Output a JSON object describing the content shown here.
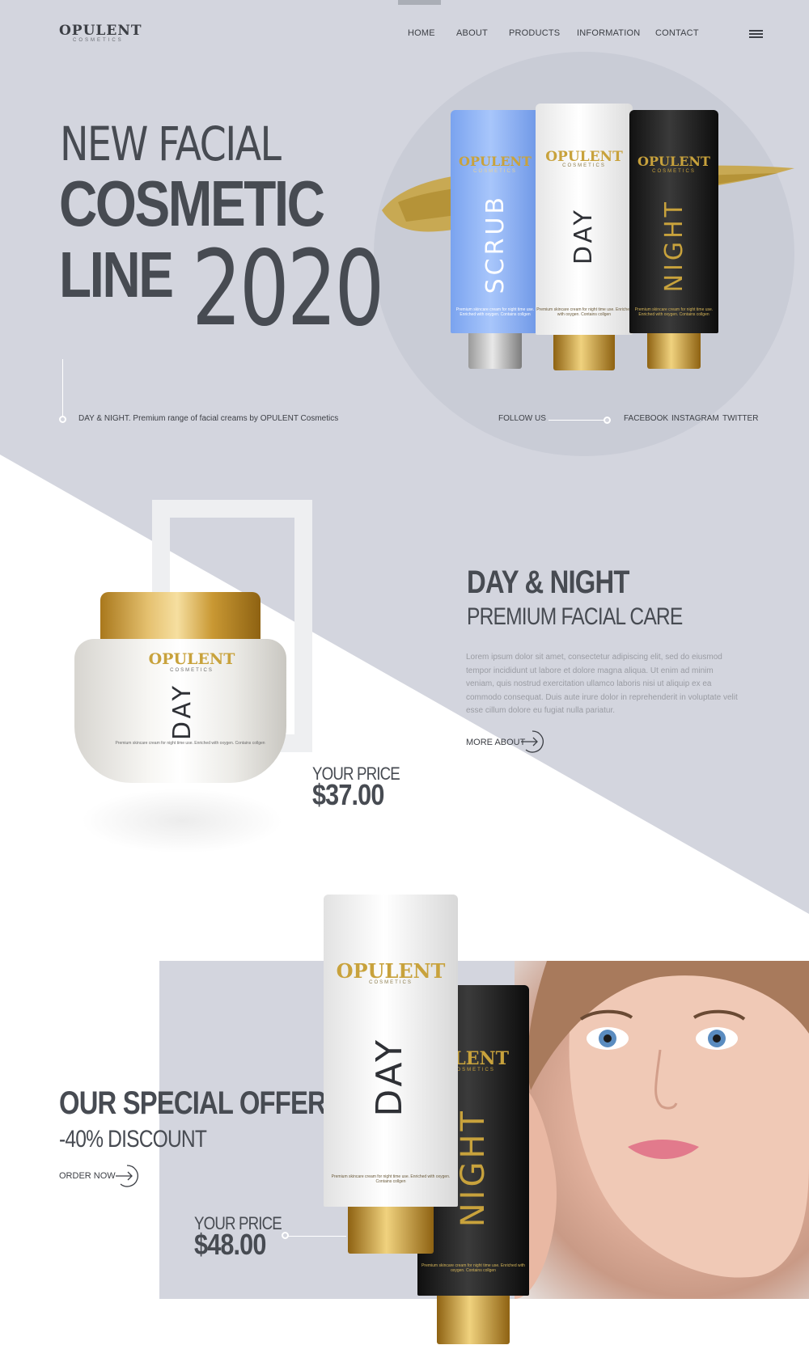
{
  "brand": {
    "name": "OPULENT",
    "tagline": "COSMETICS"
  },
  "nav": {
    "items": [
      "HOME",
      "ABOUT",
      "PRODUCTS",
      "INFORMATION",
      "CONTACT"
    ],
    "menu_icon": "hamburger-menu-icon"
  },
  "hero": {
    "line1": "NEW FACIAL",
    "line2": "COSMETIC",
    "line3": "LINE",
    "year": "2020",
    "caption": "DAY & NIGHT. Premium range of facial creams by OPULENT Cosmetics",
    "follow_label": "FOLLOW US",
    "social": [
      "FACEBOOK",
      "INSTAGRAM",
      "TWITTER"
    ],
    "tubes": [
      {
        "brand": "OPULENT",
        "sub": "COSMETICS",
        "name": "SCRUB",
        "small": "Premium skincare cream for night time use. Enriched with oxygen. Contains collgen"
      },
      {
        "brand": "OPULENT",
        "sub": "COSMETICS",
        "name": "DAY",
        "small": "Premium skincare cream for night time use. Enriched with oxygen. Contains collgen"
      },
      {
        "brand": "OPULENT",
        "sub": "COSMETICS",
        "name": "NIGHT",
        "small": "Premium skincare cream for night time use. Enriched with oxygen. Contains collgen"
      }
    ]
  },
  "day_night": {
    "title": "DAY & NIGHT",
    "subtitle": "PREMIUM FACIAL CARE",
    "body": "Lorem ipsum dolor sit amet, consectetur adipiscing elit, sed do eiusmod tempor incididunt ut labore et dolore magna aliqua. Ut enim ad minim veniam, quis nostrud exercitation ullamco laboris nisi ut aliquip ex ea commodo consequat. Duis aute irure dolor in reprehenderit in voluptate velit esse cillum dolore eu fugiat nulla pariatur.",
    "link": "MORE ABOUT",
    "price_label": "YOUR PRICE",
    "price": "$37.00",
    "jar": {
      "brand": "OPULENT",
      "sub": "COSMETICS",
      "name": "DAY",
      "small": "Premium skincare cream for night time use. Enriched with oxygen. Contains collgen"
    }
  },
  "offer": {
    "title": "OUR SPECIAL OFFER!",
    "subtitle": "-40% DISCOUNT",
    "link": "ORDER NOW",
    "price_label": "YOUR PRICE",
    "price": "$48.00",
    "tube_day": {
      "brand": "OPULENT",
      "sub": "COSMETICS",
      "name": "DAY",
      "small": "Premium skincare cream for night time use. Enriched with oxygen. Contains collgen"
    },
    "tube_night": {
      "brand": "ULENT",
      "sub": "COSMETICS",
      "name": "NIGHT",
      "small": "Premium skincare cream for night time use. Enriched with oxygen. Contains collgen"
    }
  },
  "colors": {
    "background_grey": "#d3d5de",
    "text_dark": "#474b52",
    "gold": "#c8a23c",
    "scrub_blue": "#8fb4f4"
  }
}
